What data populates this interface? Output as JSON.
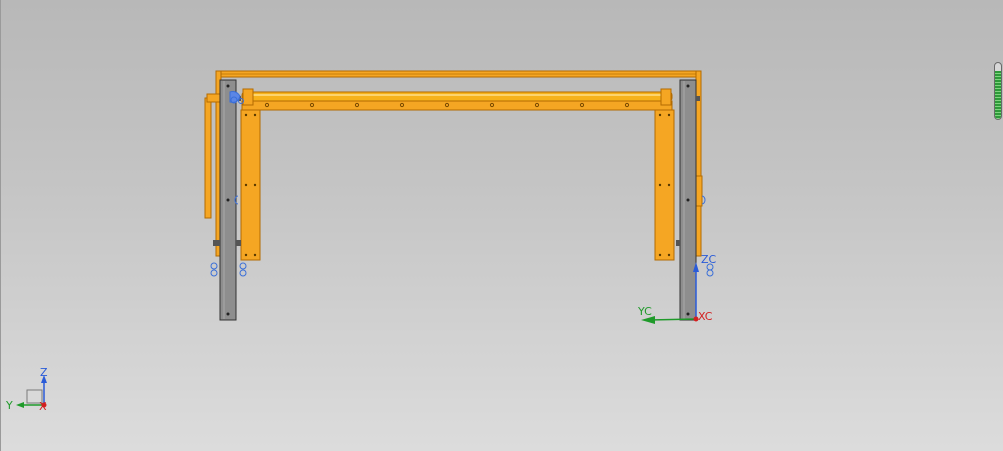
{
  "view": {
    "background": "#c6c6c6",
    "model_color": "#f5a623",
    "model_edge": "#b36b00",
    "post_color": "#8e8e8e",
    "hardware_color": "#3a6fd8"
  },
  "wcs": {
    "labels": {
      "x": "XC",
      "y": "YC",
      "z": "ZC"
    },
    "colors": {
      "x": "#d32020",
      "y": "#1f9a2a",
      "z": "#2a5bd8"
    }
  },
  "triad": {
    "labels": {
      "x": "X",
      "y": "Y",
      "z": "Z"
    },
    "colors": {
      "x": "#d32020",
      "y": "#1f9a2a",
      "z": "#2a5bd8"
    }
  },
  "zoom_gauge": {
    "level": 0.85
  }
}
